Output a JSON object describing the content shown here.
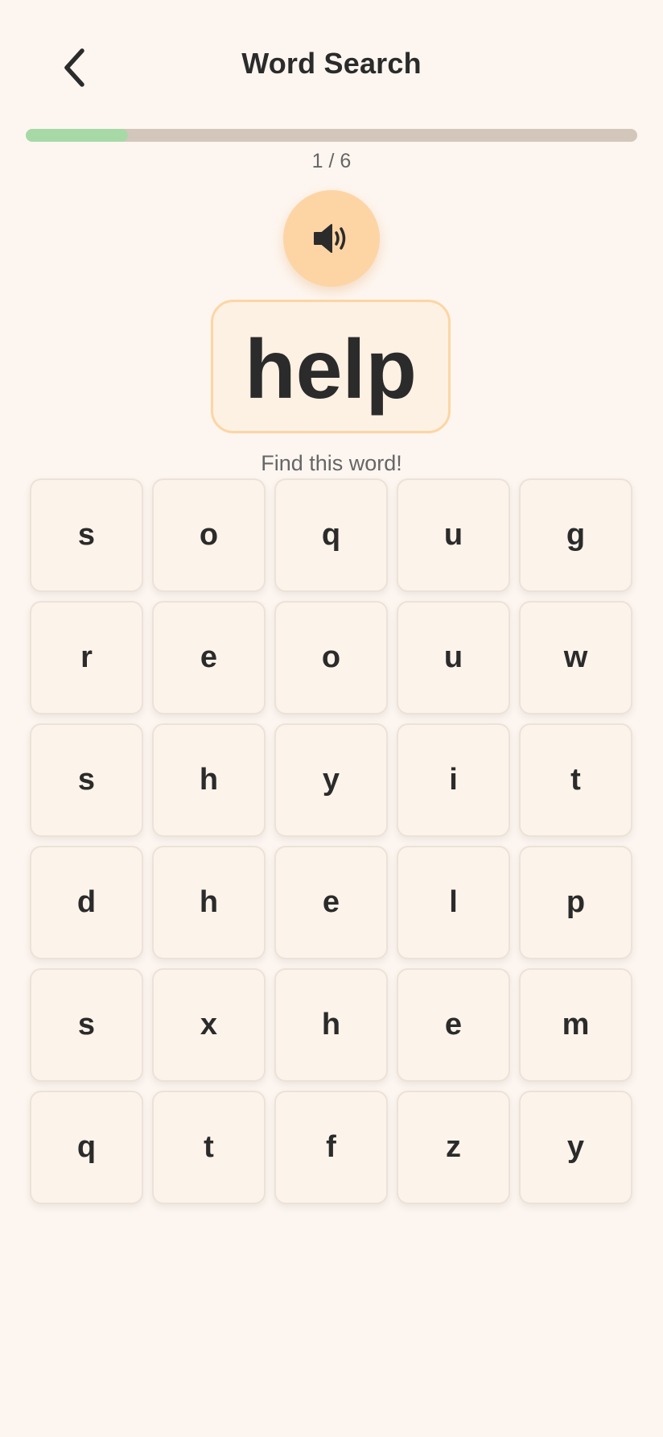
{
  "header": {
    "title": "Word Search",
    "back_icon": "chevron-left-icon"
  },
  "progress": {
    "current": 1,
    "total": 6,
    "text": "1 / 6",
    "fraction": 0.167,
    "fill_color": "#a7d9a7",
    "track_color": "#d3c7bb"
  },
  "audio": {
    "icon": "speaker-icon",
    "color": "#fdd5a5"
  },
  "target": {
    "word": "help",
    "instruction": "Find this word!"
  },
  "grid": {
    "rows": [
      [
        "s",
        "o",
        "q",
        "u",
        "g"
      ],
      [
        "r",
        "e",
        "o",
        "u",
        "w"
      ],
      [
        "s",
        "h",
        "y",
        "i",
        "t"
      ],
      [
        "d",
        "h",
        "e",
        "l",
        "p"
      ],
      [
        "s",
        "x",
        "h",
        "e",
        "m"
      ],
      [
        "q",
        "t",
        "f",
        "z",
        "y"
      ]
    ]
  }
}
